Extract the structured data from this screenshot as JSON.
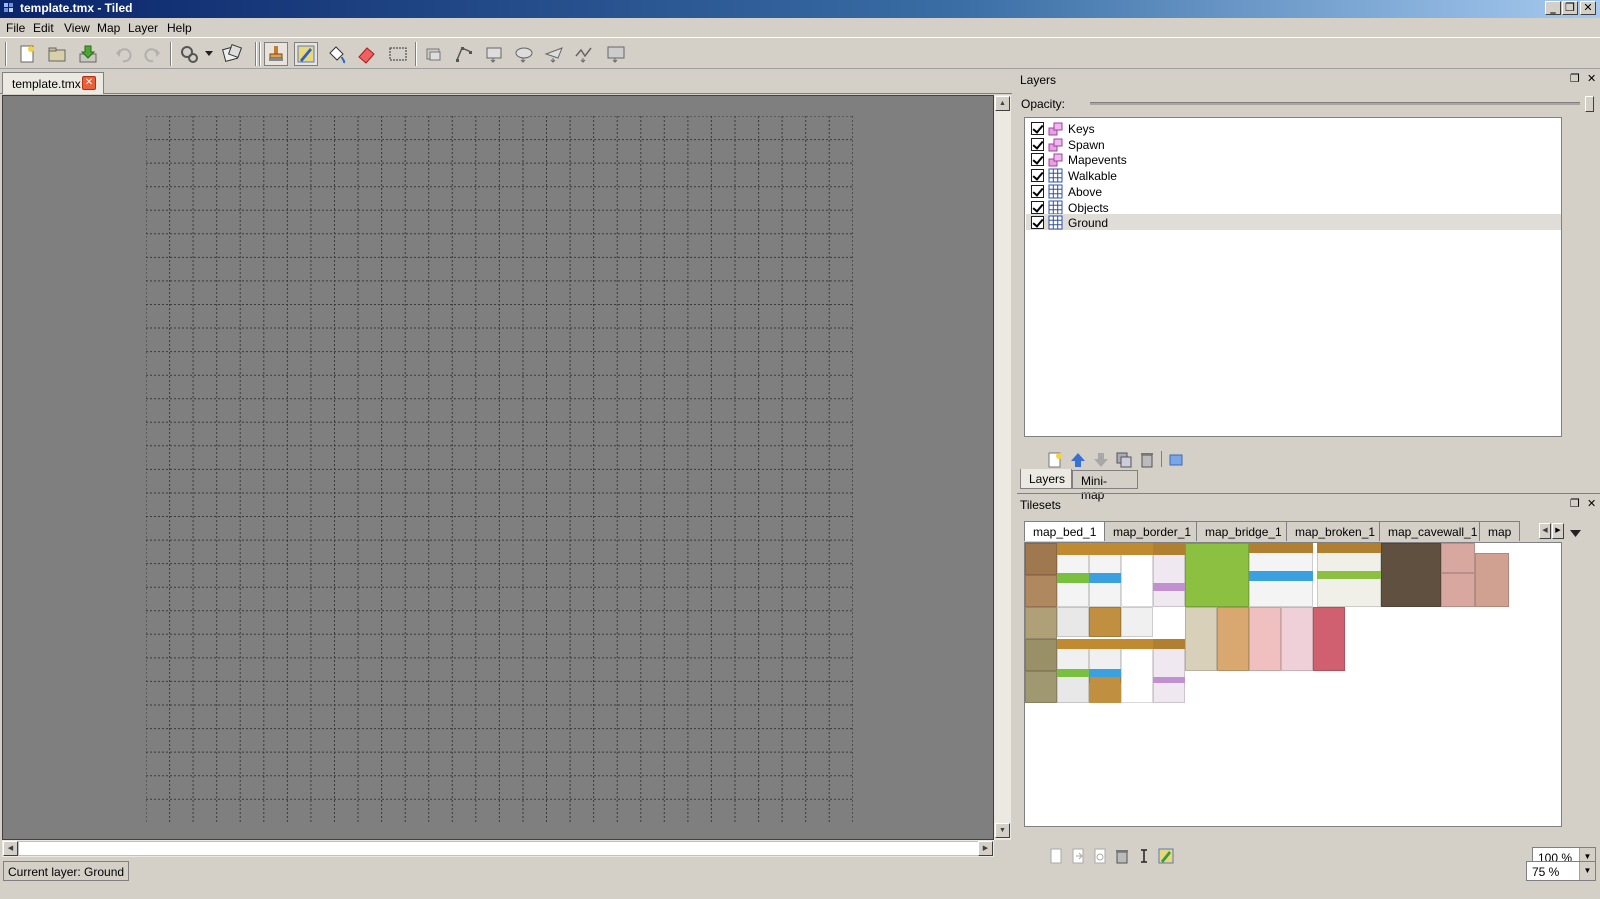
{
  "window": {
    "title": "template.tmx - Tiled"
  },
  "menu": [
    "File",
    "Edit",
    "View",
    "Map",
    "Layer",
    "Help"
  ],
  "toolbar": {
    "icons": [
      "new-map-icon",
      "open-icon",
      "save-icon",
      "undo-icon",
      "redo-icon",
      "random-mode-icon",
      "dice-icon",
      "stamp-brush-icon",
      "terrain-brush-icon",
      "bucket-fill-icon",
      "eraser-icon",
      "rectangular-select-icon",
      "select-objects-icon",
      "edit-polygons-icon",
      "insert-rectangle-icon",
      "insert-ellipse-icon",
      "insert-polygon-icon",
      "insert-polyline-icon",
      "insert-tile-icon"
    ]
  },
  "document": {
    "tab_label": "template.tmx"
  },
  "layers_panel": {
    "title": "Layers",
    "opacity_label": "Opacity:",
    "opacity": 1.0,
    "layers": [
      {
        "name": "Keys",
        "type": "object",
        "visible": true
      },
      {
        "name": "Spawn",
        "type": "object",
        "visible": true
      },
      {
        "name": "Mapevents",
        "type": "object",
        "visible": true
      },
      {
        "name": "Walkable",
        "type": "tile",
        "visible": true
      },
      {
        "name": "Above",
        "type": "tile",
        "visible": true
      },
      {
        "name": "Objects",
        "type": "tile",
        "visible": true
      },
      {
        "name": "Ground",
        "type": "tile",
        "visible": true,
        "selected": true
      }
    ],
    "tabs": [
      "Layers",
      "Mini-map"
    ]
  },
  "tilesets_panel": {
    "title": "Tilesets",
    "tabs": [
      "map_bed_1",
      "map_border_1",
      "map_bridge_1",
      "map_broken_1",
      "map_cavewall_1",
      "map"
    ],
    "zoom": "100 %"
  },
  "status": {
    "current_layer": "Current layer: Ground",
    "zoom": "75 %"
  },
  "colors": {
    "map_bg": "#7f7f7f",
    "selected_row": "#e0ddd8",
    "chrome": "#d4d0c8"
  }
}
